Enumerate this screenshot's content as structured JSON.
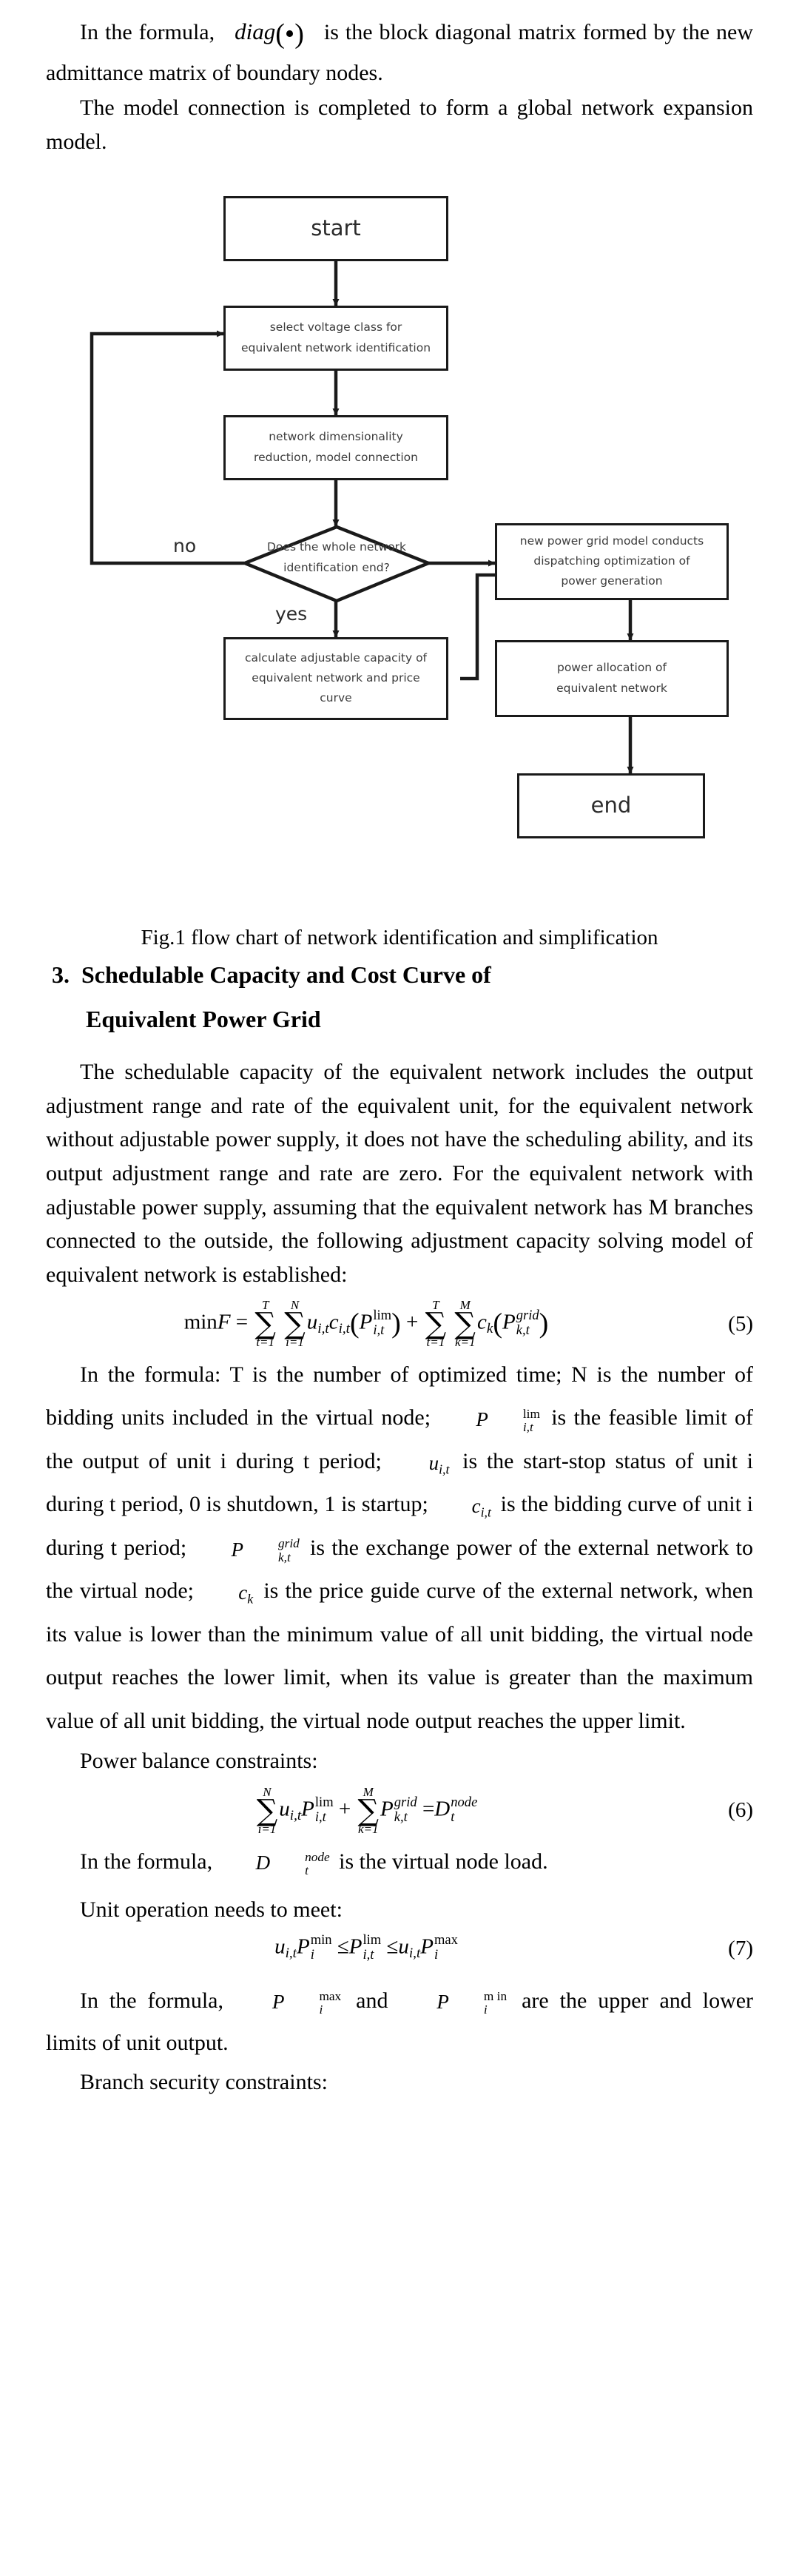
{
  "paragraphs": {
    "p1_part1": "In the formula,",
    "p1_math": "diag",
    "p1_math_arg": "(•)",
    "p1_part2": "is the block diagonal matrix formed by the new admittance matrix of boundary nodes.",
    "p2": "The model connection is completed to form a global network expansion model.",
    "p3": "The schedulable capacity of the equivalent network includes the output adjustment range and rate of the equivalent unit, for the equivalent network without adjustable power supply, it does not have the scheduling ability, and its output adjustment range and rate are zero. For the equivalent network with adjustable power supply, assuming that the equivalent network has M branches connected to the outside, the following adjustment capacity solving model of equivalent network is established:",
    "p4_a": "In the formula: T is the number of optimized time; N is the",
    "p4_b": "number of bidding units included in the virtual node;",
    "p4_c": "is the",
    "p4_d": "feasible limit of the output of unit i during t period;",
    "p4_e": "is the",
    "p4_f": "start-stop status of unit i during t period, 0 is shutdown, 1 is startup;",
    "p4_g": "is the bidding curve of unit i during t period;",
    "p4_h": "is the",
    "p4_i": "exchange power of the external network to the virtual node;",
    "p4_j": "is",
    "p4_k": "the price guide curve of the external network, when its value is lower than the minimum value of all unit bidding, the virtual node output reaches the lower limit, when its value is greater than the maximum value of all unit bidding, the virtual node output reaches the upper limit.",
    "p5": "Power balance constraints:",
    "p6_a": "In the formula,",
    "p6_b": "is the virtual node load.",
    "p7": "Unit operation needs to meet:",
    "p8_a": "In the formula,",
    "p8_b": "and",
    "p8_c": "are the upper and lower limits of unit output.",
    "p9": "Branch security constraints:"
  },
  "figure": {
    "caption": "Fig.1 flow chart of network identification and simplification",
    "nodes": {
      "start": "start",
      "select_voltage": "select voltage class for\nequivalent network identification",
      "dimensionality": "network dimensionality\nreduction, model connection",
      "decision": "Does the whole network\nidentification end?",
      "calc_capacity": "calculate adjustable capacity of\nequivalent network and price\ncurve",
      "dispatch": "new power grid model conducts\ndispatching optimization of\npower  generation",
      "power_alloc": "power allocation of\nequivalent network",
      "end": "end"
    },
    "labels": {
      "no": "no",
      "yes": "yes"
    },
    "decision_line1": "Does the whole network",
    "decision_line2": "identification end?",
    "select_line1": "select voltage class for",
    "select_line2": "equivalent network identification",
    "dim_line1": "network dimensionality",
    "dim_line2": "reduction, model connection",
    "calc_line1": "calculate adjustable capacity of",
    "calc_line2": "equivalent network and price",
    "calc_line3": "curve",
    "disp_line1": "new power grid model conducts",
    "disp_line2": "dispatching optimization of",
    "disp_line3": "power  generation",
    "alloc_line1": "power allocation of",
    "alloc_line2": "equivalent network"
  },
  "section": {
    "number": "3.",
    "title_line1": "Schedulable Capacity and Cost Curve of",
    "title_line2": "Equivalent Power Grid"
  },
  "equations": {
    "eq5_number": "(5)",
    "eq6_number": "(6)",
    "eq7_number": "(7)",
    "eq5_min": "min",
    "eq5_F": "F",
    "eq5_eq": "=",
    "eq5_sum1_top": "T",
    "eq5_sum1_bot": "t=1",
    "eq5_sum2_top": "N",
    "eq5_sum2_bot": "i=1",
    "eq5_u": "u",
    "eq5_u_sub": "i,t",
    "eq5_c": "c",
    "eq5_c_sub": "i,t",
    "eq5_P": "P",
    "eq5_P_sup": "lim",
    "eq5_P_sub": "i,t",
    "eq5_plus": "+",
    "eq5_sum3_top": "T",
    "eq5_sum3_bot": "t=1",
    "eq5_sum4_top": "M",
    "eq5_sum4_bot": "k=1",
    "eq5_ck": "c",
    "eq5_ck_sub": "k",
    "eq5_Pg": "P",
    "eq5_Pg_sup": "grid",
    "eq5_Pg_sub": "k,t",
    "eq6_sum1_top": "N",
    "eq6_sum1_bot": "i=1",
    "eq6_sum2_top": "M",
    "eq6_sum2_bot": "k=1",
    "eq6_D": "D",
    "eq6_D_sup": "node",
    "eq6_D_sub": "t",
    "eq7_left_u": "u",
    "eq7_left_u_sub": "i,t",
    "eq7_Pmin": "P",
    "eq7_Pmin_sup": "min",
    "eq7_Pmin_sub": "i",
    "eq7_le": "≤",
    "eq7_Pmid": "P",
    "eq7_Pmid_sup": "lim",
    "eq7_Pmid_sub": "i,t",
    "eq7_Pmax": "P",
    "eq7_Pmax_sup": "max",
    "eq7_Pmax_sub": "i"
  },
  "inline_symbols": {
    "P_lim_it": {
      "base": "P",
      "sup": "lim",
      "sub": "i,t"
    },
    "u_it": {
      "base": "u",
      "sub": "i,t"
    },
    "c_it": {
      "base": "c",
      "sub": "i,t"
    },
    "P_grid_kt": {
      "base": "P",
      "sup": "grid",
      "sub": "k,t"
    },
    "c_k": {
      "base": "c",
      "sub": "k"
    },
    "D_node_t": {
      "base": "D",
      "sup": "node",
      "sub": "t"
    },
    "P_max_i": {
      "base": "P",
      "sup": "max",
      "sub": "i"
    },
    "P_min_i": {
      "base": "P",
      "sup": "m in",
      "sub": "i"
    }
  },
  "colors": {
    "text": "#000000",
    "flow_stroke": "#1a1a1a",
    "flow_text": "#3c3c3c",
    "page_bg": "#ffffff"
  }
}
